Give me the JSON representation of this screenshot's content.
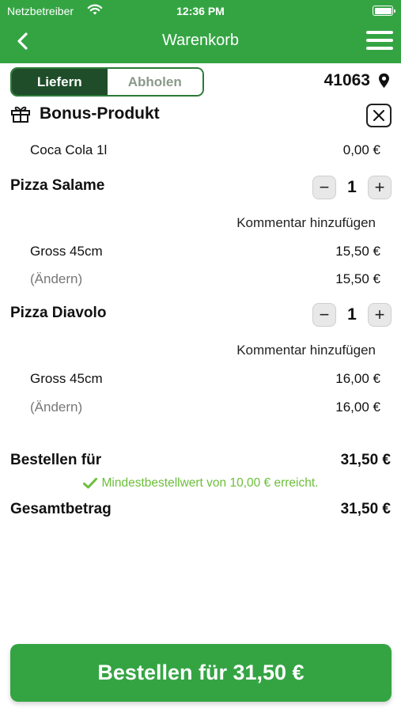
{
  "status_bar": {
    "carrier": "Netzbetreiber",
    "time": "12:36 PM"
  },
  "header": {
    "title": "Warenkorb",
    "back_icon": "chevron-left-icon",
    "menu_icon": "hamburger-menu-icon"
  },
  "delivery_toggle": {
    "options": [
      "Liefern",
      "Abholen"
    ],
    "selected": "Liefern"
  },
  "postcode": "41063",
  "bonus": {
    "title": "Bonus-Produkt",
    "item_name": "Coca Cola 1l",
    "item_price": "0,00 €"
  },
  "cart_items": [
    {
      "name": "Pizza Salame",
      "quantity": "1",
      "comment_label": "Kommentar hinzufügen",
      "option": "Gross 45cm",
      "option_price": "15,50 €",
      "change_label": "(Ändern)",
      "total": "15,50 €"
    },
    {
      "name": "Pizza Diavolo",
      "quantity": "1",
      "comment_label": "Kommentar hinzufügen",
      "option": "Gross 45cm",
      "option_price": "16,00 €",
      "change_label": "(Ändern)",
      "total": "16,00 €"
    }
  ],
  "summary": {
    "order_for_label": "Bestellen für",
    "order_for_value": "31,50 €",
    "min_order_note": "Mindestbestellwert von 10,00 € erreicht.",
    "total_label": "Gesamtbetrag",
    "total_value": "31,50 €"
  },
  "order_button": "Bestellen für 31,50 €",
  "colors": {
    "brand_green": "#34a443",
    "toggle_active": "#1f4d2a",
    "success_green": "#6cbf3a"
  }
}
